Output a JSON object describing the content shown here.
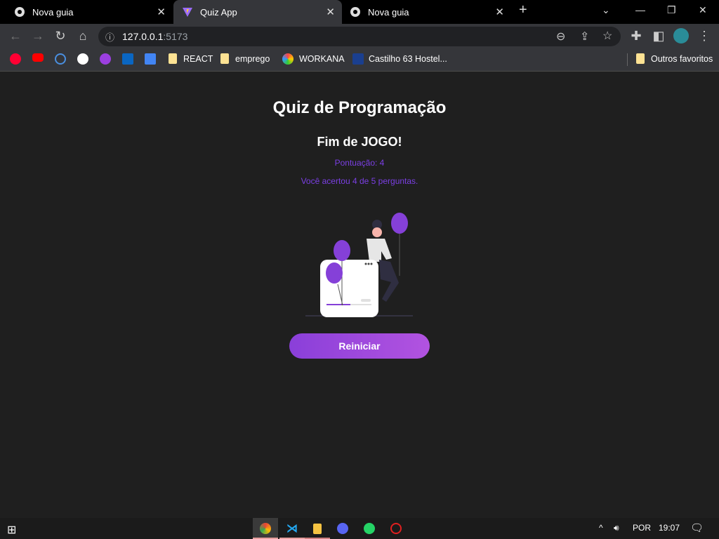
{
  "browser": {
    "tabs": [
      {
        "title": "Nova guia",
        "icon": "chrome-icon"
      },
      {
        "title": "Quiz App",
        "icon": "vite-icon",
        "active": true
      },
      {
        "title": "Nova guia",
        "icon": "chrome-icon"
      }
    ],
    "url_host": "127.0.0.1",
    "url_port": ":5173",
    "bookmarks": [
      {
        "label": "REACT"
      },
      {
        "label": "emprego"
      },
      {
        "label": "WORKANA"
      },
      {
        "label": "Castilho 63 Hostel..."
      }
    ],
    "other_bookmarks": "Outros favoritos"
  },
  "page": {
    "title": "Quiz de Programação",
    "subtitle": "Fim de JOGO!",
    "score": "Pontuação: 4",
    "summary": "Você acertou 4 de 5 perguntas.",
    "restart": "Reiniciar",
    "accent": "#7b3fe4"
  },
  "taskbar": {
    "lang": "POR",
    "time": "19:07"
  }
}
